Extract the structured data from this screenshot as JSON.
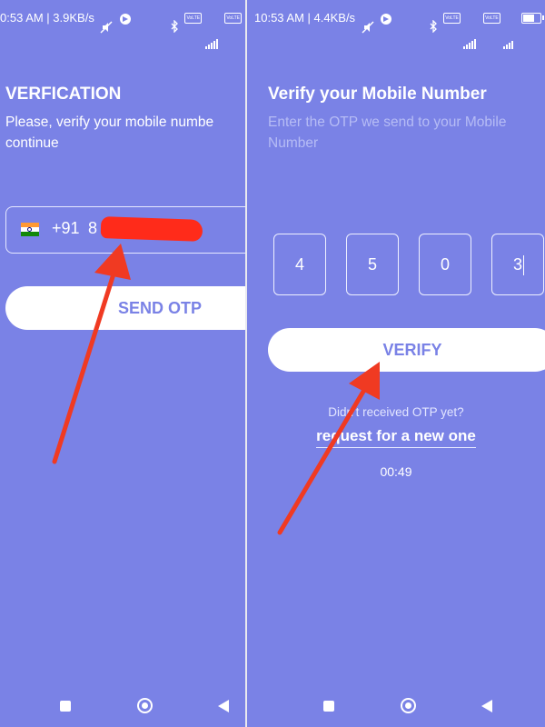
{
  "left_screen": {
    "status_bar": {
      "time_speed": "0:53 AM | 3.9KB/s",
      "network_label": "4G+",
      "data_badge": "VoLTE"
    },
    "heading": "VERFICATION",
    "subtext_line1": "Please, verify your mobile numbe",
    "subtext_line2": "continue",
    "phone_field": {
      "flag_icon": "india-flag-icon",
      "country_code": "+91",
      "number_visible": "8"
    },
    "send_otp_label": "SEND OTP"
  },
  "right_screen": {
    "status_bar": {
      "time_speed": "10:53 AM | 4.4KB/s",
      "network_label": "4G+",
      "data_badge": "VoLTE"
    },
    "heading": "Verify your Mobile Number",
    "subtext_line1": "Enter the OTP we send to your Mobile",
    "subtext_line2": "Number",
    "otp_digits": [
      "4",
      "5",
      "0",
      "3"
    ],
    "verify_label": "VERIFY",
    "resend_question": "Didn't received OTP yet?",
    "resend_link": "request for a new one",
    "timer": "00:49"
  },
  "colors": {
    "background": "#7a82e6",
    "button_bg": "#ffffff",
    "button_text": "#7a82e6",
    "annotation_arrow": "#f03a22",
    "redaction": "#ff2b1a"
  }
}
